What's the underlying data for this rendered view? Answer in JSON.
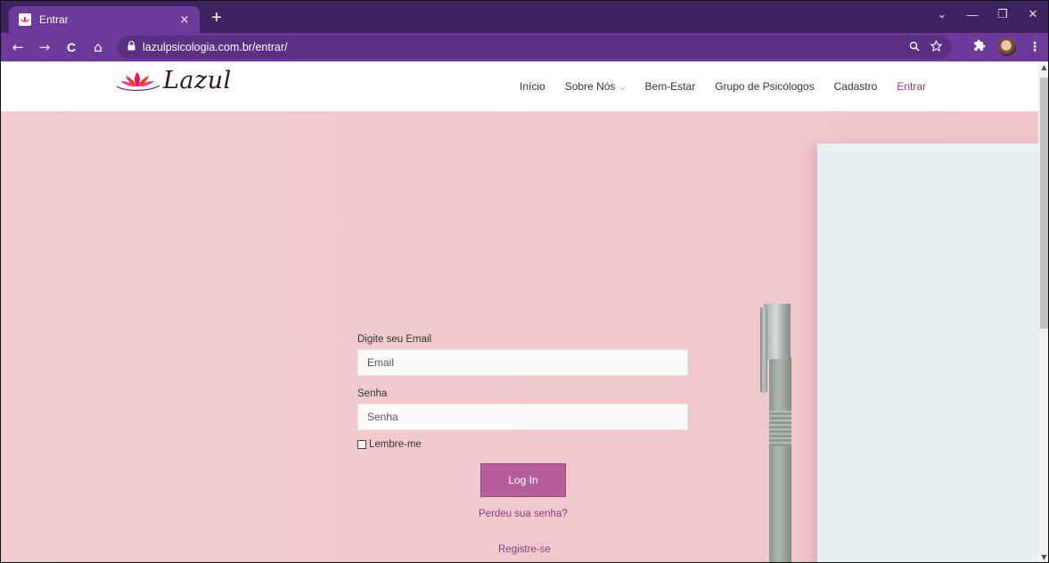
{
  "browser": {
    "tab": {
      "title": "Entrar",
      "close": "×"
    },
    "new_tab": "+",
    "window_controls": {
      "dropdown": "⌄",
      "minimize": "—",
      "restore": "❐",
      "close": "✕"
    },
    "nav": {
      "back": "←",
      "forward": "→",
      "reload": "C",
      "home": "⌂"
    },
    "url": "lazulpsicologia.com.br/entrar/",
    "accent": "#6d3a9c"
  },
  "site": {
    "logo_text": "Lazul",
    "nav": [
      {
        "label": "Início"
      },
      {
        "label": "Sobre Nós"
      },
      {
        "label": "Bem-Estar"
      },
      {
        "label": "Grupo de Psicólogos"
      },
      {
        "label": "Cadastro"
      },
      {
        "label": "Entrar"
      }
    ],
    "brand_color": "#8a3d86"
  },
  "form": {
    "email_label": "Digite seu Email",
    "email_placeholder": "Email",
    "password_label": "Senha",
    "password_placeholder": "Senha",
    "remember_label": "Lembre-me",
    "login_button": "Log In",
    "lost_password": "Perdeu sua senha?",
    "register": "Registre-se",
    "button_color": "#b65d9a"
  }
}
